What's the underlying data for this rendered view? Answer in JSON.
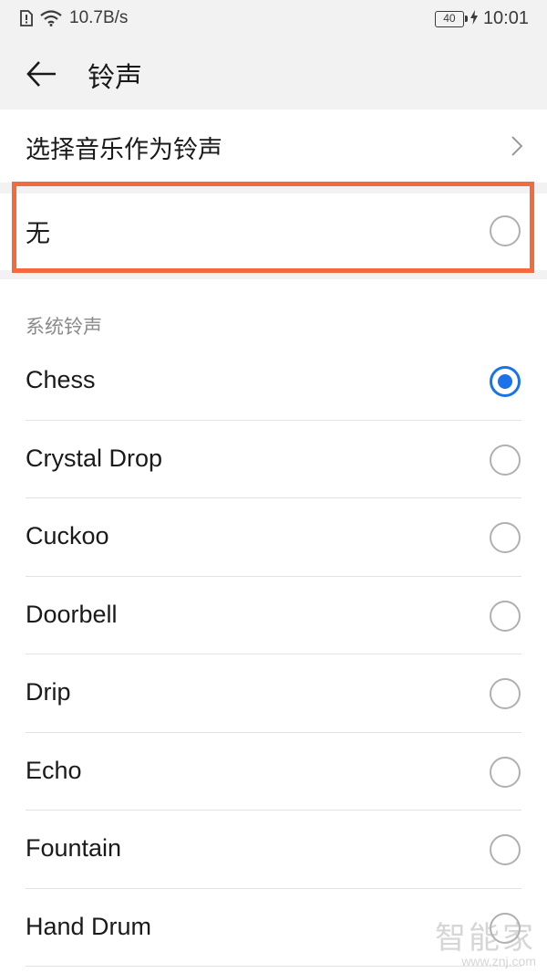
{
  "status_bar": {
    "net_speed": "10.7B/s",
    "battery": "40",
    "time": "10:01"
  },
  "app_bar": {
    "title": "铃声"
  },
  "select_music": {
    "label": "选择音乐作为铃声"
  },
  "none_option": {
    "label": "无",
    "selected": false
  },
  "section": {
    "header": "系统铃声"
  },
  "ringtones": [
    {
      "name": "Chess",
      "selected": true
    },
    {
      "name": "Crystal Drop",
      "selected": false
    },
    {
      "name": "Cuckoo",
      "selected": false
    },
    {
      "name": "Doorbell",
      "selected": false
    },
    {
      "name": "Drip",
      "selected": false
    },
    {
      "name": "Echo",
      "selected": false
    },
    {
      "name": "Fountain",
      "selected": false
    },
    {
      "name": "Hand Drum",
      "selected": false
    }
  ],
  "watermark": {
    "text": "智能家",
    "url": "www.znj.com"
  },
  "colors": {
    "accent": "#1a73e8",
    "highlight": "#f26a3e",
    "background": "#f2f2f2"
  }
}
